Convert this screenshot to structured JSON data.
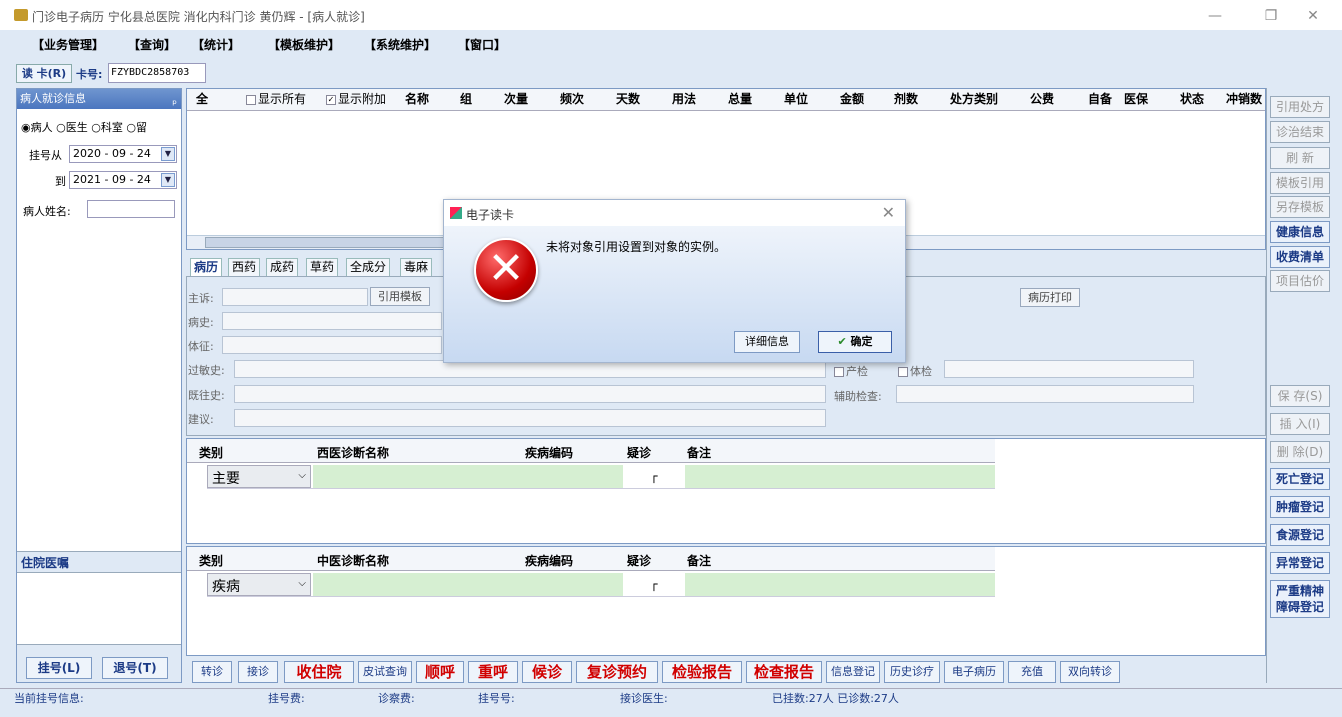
{
  "window": {
    "title": "门诊电子病历 宁化县总医院 消化内科门诊 黄仍辉 - [病人就诊]",
    "minimize": "—",
    "restore": "❐",
    "close": "✕"
  },
  "menu": [
    "【业务管理】",
    "【查询】",
    "【统计】",
    "【模板维护】",
    "【系统维护】",
    "【窗口】"
  ],
  "card": {
    "read_button": "读 卡(R)",
    "card_label": "卡号:",
    "card_value": "FZYBDC2858703"
  },
  "left_panel": {
    "header": "病人就诊信息",
    "pin": "ₚ",
    "radios": [
      {
        "label": "病人",
        "checked": true
      },
      {
        "label": "医生",
        "checked": false
      },
      {
        "label": "科室",
        "checked": false
      },
      {
        "label": "留",
        "checked": false
      }
    ],
    "reg_from_label": "挂号从",
    "reg_from": "2020 - 09 - 24",
    "reg_to_label": "到",
    "reg_to": "2021 - 09 - 24",
    "name_label": "病人姓名:",
    "lower_header": "住院医嘱",
    "register_button": "挂号(L)",
    "unregister_button": "退号(T)"
  },
  "rx_grid": {
    "all": "全",
    "show_all": "显示所有",
    "show_extra": "显示附加",
    "show_extra_checked": true,
    "columns": [
      "名称",
      "组",
      "次量",
      "频次",
      "天数",
      "用法",
      "总量",
      "单位",
      "金额",
      "剂数",
      "处方类别",
      "公费",
      "自备",
      "医保",
      "状态",
      "冲销数"
    ]
  },
  "tabs": [
    "病历",
    "西药",
    "成药",
    "草药",
    "全成分",
    "毒麻"
  ],
  "emr": {
    "chief_complaint": "主诉:",
    "ref_template": "引用模板",
    "history": "病史:",
    "exam": "体征:",
    "allergy": "过敏史:",
    "past_history": "既往史:",
    "advice": "建议:",
    "print_button": "病历打印",
    "prenatal": "产检",
    "physical": "体检",
    "aux_exam": "辅助检查:"
  },
  "west_diag": {
    "columns": [
      "类别",
      "西医诊断名称",
      "疾病编码",
      "疑诊",
      "备注"
    ],
    "row_type": "主要"
  },
  "tcm_diag": {
    "columns": [
      "类别",
      "中医诊断名称",
      "疾病编码",
      "疑诊",
      "备注"
    ],
    "row_type": "疾病"
  },
  "toolbar": [
    {
      "label": "转诊",
      "style": "normal"
    },
    {
      "label": "接诊",
      "style": "normal"
    },
    {
      "label": "收住院",
      "style": "red"
    },
    {
      "label": "皮试查询",
      "style": "normal"
    },
    {
      "label": "顺呼",
      "style": "red"
    },
    {
      "label": "重呼",
      "style": "red"
    },
    {
      "label": "候诊",
      "style": "red"
    },
    {
      "label": "复诊预约",
      "style": "red"
    },
    {
      "label": "检验报告",
      "style": "red"
    },
    {
      "label": "检查报告",
      "style": "red"
    },
    {
      "label": "信息登记",
      "style": "normal"
    },
    {
      "label": "历史诊疗",
      "style": "normal"
    },
    {
      "label": "电子病历",
      "style": "normal"
    },
    {
      "label": "充值",
      "style": "normal"
    },
    {
      "label": "双向转诊",
      "style": "normal"
    }
  ],
  "right_buttons": [
    {
      "label": "引用处方",
      "enabled": false
    },
    {
      "label": "诊治结束",
      "enabled": false
    },
    {
      "label": "刷 新",
      "enabled": false
    },
    {
      "label": "模板引用",
      "enabled": false
    },
    {
      "label": "另存模板",
      "enabled": false
    },
    {
      "label": "健康信息",
      "enabled": true
    },
    {
      "label": "收费清单",
      "enabled": true
    },
    {
      "label": "项目估价",
      "enabled": false
    },
    {
      "label": "保 存(S)",
      "enabled": false
    },
    {
      "label": "插 入(I)",
      "enabled": false
    },
    {
      "label": "删 除(D)",
      "enabled": false
    },
    {
      "label": "死亡登记",
      "enabled": true
    },
    {
      "label": "肿瘤登记",
      "enabled": true
    },
    {
      "label": "食源登记",
      "enabled": true
    },
    {
      "label": "异常登记",
      "enabled": true
    },
    {
      "label": "严重精神障碍登记",
      "enabled": true
    }
  ],
  "status": {
    "current_reg": "当前挂号信息:",
    "reg_fee": "挂号费:",
    "diag_fee": "诊察费:",
    "reg_no": "挂号号:",
    "doctor": "接诊医生:",
    "counts": "已挂数:27人 已诊数:27人"
  },
  "dialog": {
    "title": "电子读卡",
    "message": "未将对象引用设置到对象的实例。",
    "detail_button": "详细信息",
    "ok_button": "确定",
    "error_icon": "error-x-icon"
  }
}
